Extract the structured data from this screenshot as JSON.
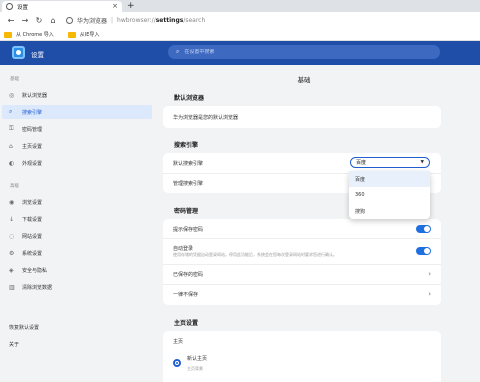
{
  "tab": {
    "title": "设置"
  },
  "toolbar": {
    "back": "←",
    "forward": "→",
    "reload": "↻",
    "home": "⌂",
    "brand": "华为浏览器",
    "url_prefix": "hwbrowser://",
    "url_bold": "settings",
    "url_suffix": "/search"
  },
  "bookmarks": [
    {
      "label": "从 Chrome 导入"
    },
    {
      "label": "从IE导入"
    }
  ],
  "header": {
    "title": "设置",
    "search_placeholder": "在设置中搜索"
  },
  "sidebar": {
    "section_basic": "基础",
    "basic_items": [
      {
        "label": "默认浏览器",
        "icon": "browser-icon"
      },
      {
        "label": "搜索引擎",
        "icon": "search-icon"
      },
      {
        "label": "密码管理",
        "icon": "key-icon"
      },
      {
        "label": "主页设置",
        "icon": "home-icon"
      },
      {
        "label": "外观设置",
        "icon": "palette-icon"
      }
    ],
    "section_advanced": "高级",
    "advanced_items": [
      {
        "label": "浏览设置",
        "icon": "eye-icon"
      },
      {
        "label": "下载设置",
        "icon": "download-icon"
      },
      {
        "label": "网站设置",
        "icon": "globe-icon"
      },
      {
        "label": "系统设置",
        "icon": "gear-icon"
      },
      {
        "label": "安全与隐私",
        "icon": "shield-icon"
      },
      {
        "label": "清除浏览数据",
        "icon": "trash-icon"
      }
    ],
    "reset": "恢复默认设置",
    "about": "关于"
  },
  "main": {
    "title": "基础",
    "default_browser": {
      "heading": "默认浏览器",
      "row": "华为浏览器是您的默认浏览器"
    },
    "search_engine": {
      "heading": "搜索引擎",
      "default_label": "默认搜索引擎",
      "selected": "百度",
      "manage_label": "管理搜索引擎",
      "options": [
        "百度",
        "360",
        "搜狗"
      ]
    },
    "password": {
      "heading": "密码管理",
      "save_prompt": "提示保存密码",
      "auto_login": "自动登录",
      "auto_login_desc": "使用存储的凭据自动登录网站。停用此功能后，系统会在您每次登录网站时要求您进行确认。",
      "saved": "已保存的密码",
      "never": "一律不保存",
      "save_prompt_on": true,
      "auto_login_on": true
    },
    "homepage": {
      "heading": "主页设置",
      "row": "主页",
      "option": "新认主页",
      "option_desc": "主页背景"
    }
  },
  "colors": {
    "header": "#1f4ea8",
    "accent": "#1f6fe0",
    "active_bg": "#dce8fb"
  }
}
